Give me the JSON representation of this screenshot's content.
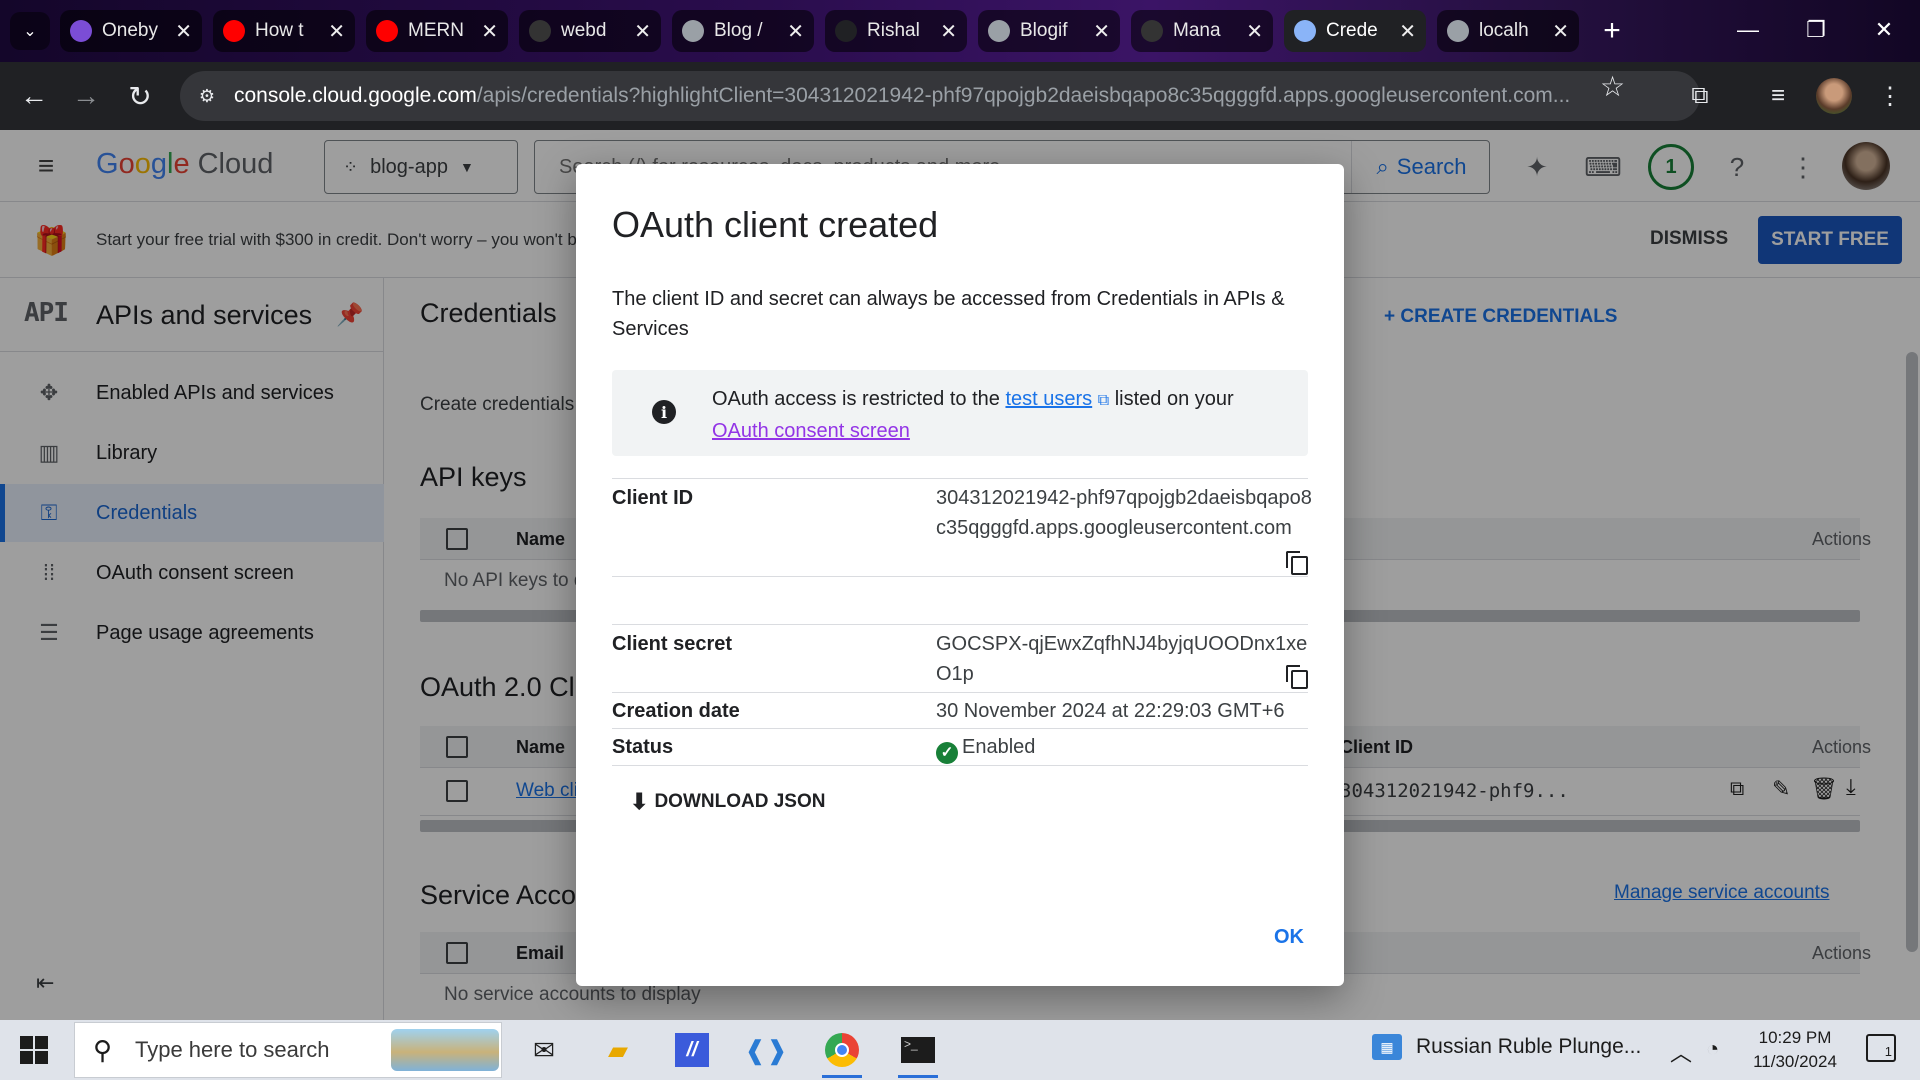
{
  "browser": {
    "tabs": [
      {
        "title": "Oneby",
        "favicon": "onebyte-icon",
        "color": "#7b4dd6"
      },
      {
        "title": "How t",
        "favicon": "youtube-icon",
        "color": "#ff0000"
      },
      {
        "title": "MERN",
        "favicon": "youtube-icon",
        "color": "#ff0000"
      },
      {
        "title": "webd",
        "favicon": "github-icon",
        "color": "#333333"
      },
      {
        "title": "Blog /",
        "favicon": "globe-icon",
        "color": "#9aa0a6"
      },
      {
        "title": "Rishal",
        "favicon": "blank-icon",
        "color": "#202124"
      },
      {
        "title": "Blogif",
        "favicon": "globe-icon",
        "color": "#9aa0a6"
      },
      {
        "title": "Mana",
        "favicon": "github-icon",
        "color": "#333333"
      },
      {
        "title": "Crede",
        "favicon": "api-icon",
        "color": "#8ab4f8",
        "active": true
      },
      {
        "title": "localh",
        "favicon": "globe-icon",
        "color": "#9aa0a6"
      }
    ],
    "url_host": "console.cloud.google.com",
    "url_path": "/apis/credentials?highlightClient=304312021942-phf97qpojgb2daeisbqapo8c35qgggfd.apps.googleusercontent.com..."
  },
  "gcp_header": {
    "logo_google": "Google",
    "logo_cloud": "Cloud",
    "project": "blog-app",
    "search_placeholder": "Search (/) for resources, docs, products and more",
    "search_button": "Search",
    "notification_count": "1"
  },
  "trial_banner": {
    "message": "Start your free trial with $300 in credit. Don't worry – you won't be charged if you run out of credits.",
    "dismiss": "DISMISS",
    "start_free": "START FREE"
  },
  "sidebar": {
    "logo": "API",
    "title": "APIs and services",
    "items": [
      {
        "label": "Enabled APIs and services",
        "icon": "enabled-apis-icon"
      },
      {
        "label": "Library",
        "icon": "library-icon"
      },
      {
        "label": "Credentials",
        "icon": "key-icon",
        "active": true
      },
      {
        "label": "OAuth consent screen",
        "icon": "consent-icon"
      },
      {
        "label": "Page usage agreements",
        "icon": "agreements-icon"
      }
    ]
  },
  "main": {
    "title": "Credentials",
    "create_credentials": "+ CREATE CREDENTIALS",
    "subtitle": "Create credentials to access your enabled APIs",
    "api_keys": {
      "title": "API keys",
      "col_name": "Name",
      "col_actions": "Actions",
      "empty": "No API keys to display"
    },
    "oauth": {
      "title": "OAuth 2.0 Client IDs",
      "col_name": "Name",
      "col_client_id": "Client ID",
      "col_actions": "Actions",
      "row_name": "Web client 1",
      "row_client_id": "304312021942-phf9..."
    },
    "service_accounts": {
      "title": "Service Accounts",
      "manage_link": "Manage service accounts",
      "col_email": "Email",
      "col_actions": "Actions",
      "empty": "No service accounts to display"
    }
  },
  "dialog": {
    "title": "OAuth client created",
    "description": "The client ID and secret can always be accessed from Credentials in APIs & Services",
    "info_prefix": "OAuth access is restricted to the ",
    "info_link": "test users",
    "info_mid": " listed on your ",
    "info_consent_link": "OAuth consent screen",
    "client_id_label": "Client ID",
    "client_id_value": "304312021942-phf97qpojgb2daeisbqapo8c35qgggfd.apps.googleusercontent.com",
    "client_secret_label": "Client secret",
    "client_secret_value": "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",
    "creation_date_label": "Creation date",
    "creation_date_value": "30 November 2024 at 22:29:03 GMT+6",
    "status_label": "Status",
    "status_value": "Enabled",
    "download_json": "DOWNLOAD JSON",
    "ok": "OK"
  },
  "taskbar": {
    "search_placeholder": "Type here to search",
    "news": "Russian Ruble Plunge...",
    "time": "10:29 PM",
    "date": "11/30/2024",
    "notification_badge": "1"
  }
}
